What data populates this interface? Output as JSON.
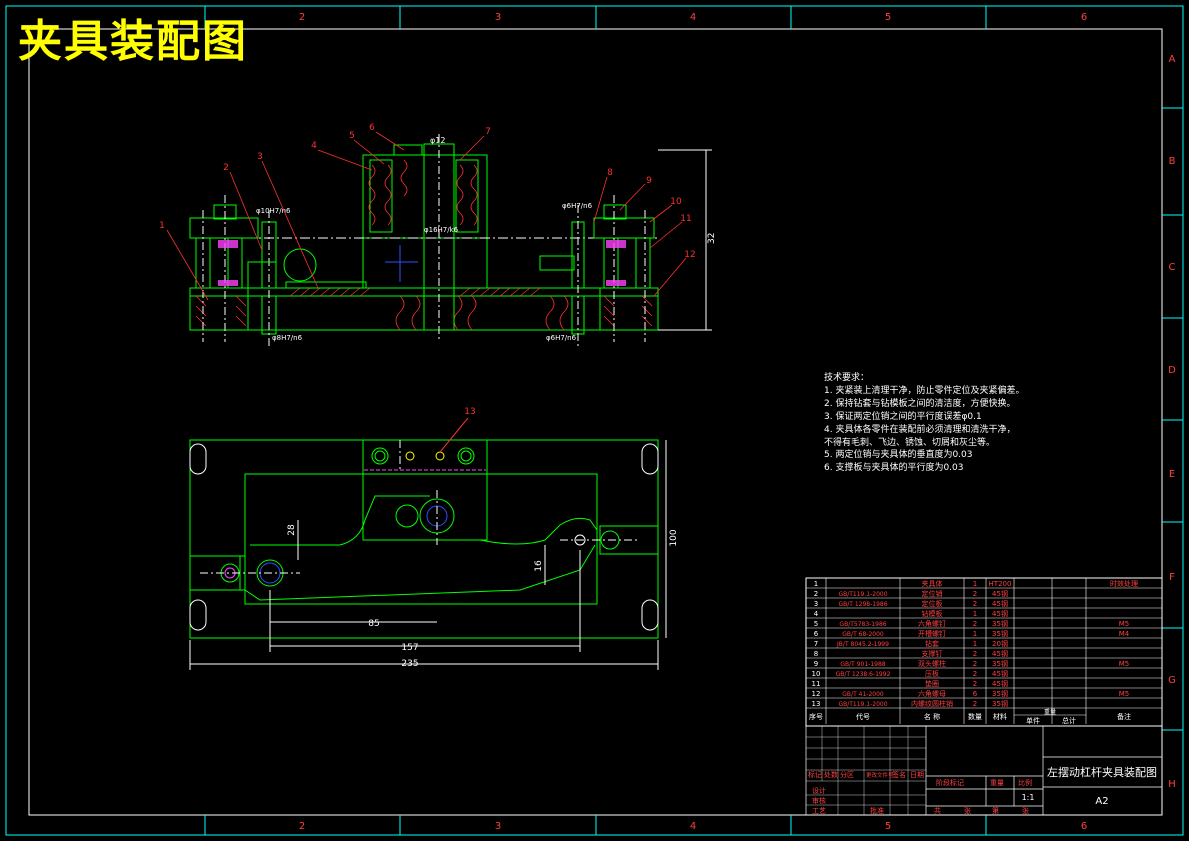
{
  "drawing": {
    "heading": "夹具装配图",
    "grid_columns": [
      "2",
      "3",
      "4",
      "5",
      "6"
    ],
    "grid_rows": [
      "A",
      "B",
      "C",
      "D",
      "E",
      "F",
      "G",
      "H"
    ],
    "front_view": {
      "balloons": [
        "1",
        "2",
        "3",
        "4",
        "5",
        "6",
        "7",
        "8",
        "9",
        "10",
        "11",
        "12"
      ],
      "dims": {
        "d12": "φ12",
        "d16": "φ16H7/k6",
        "d10": "φ10H7/n6",
        "d6": "φ6H7/n6",
        "d8": "φ8H7/n6",
        "d6b": "φ6H7/n6",
        "h32": "32"
      }
    },
    "top_view": {
      "balloons": [
        "13"
      ],
      "dims": {
        "d85": "85",
        "d157": "157",
        "d235": "235",
        "d100": "100",
        "d28": "28",
        "d16": "16"
      }
    },
    "technical_notes": {
      "title": "技术要求：",
      "lines": [
        "1. 夹紧装上清理干净，防止零件定位及夹紧偏差。",
        "2. 保持钻套与钻模板之间的清洁度，方便快换。",
        "3. 保证两定位销之间的平行度误差φ0.1",
        "4. 夹具体各零件在装配前必须清理和清洗干净，",
        "不得有毛刺、飞边、锈蚀、切屑和灰尘等。",
        "5. 两定位销与夹具体的垂直度为0.03",
        "6. 支撑板与夹具体的平行度为0.03"
      ]
    },
    "bom": {
      "headers": [
        "序号",
        "代号",
        "名 称",
        "数量",
        "材料",
        "单件",
        "总计",
        "备注"
      ],
      "weight_header": "重量",
      "rows": [
        [
          "13",
          "GB/T119.1-2000",
          "内螺纹圆柱销",
          "2",
          "35钢",
          "",
          "",
          ""
        ],
        [
          "12",
          "GB/T 41-2000",
          "六角螺母",
          "6",
          "35钢",
          "",
          "",
          "M5"
        ],
        [
          "11",
          "",
          "垫圈",
          "2",
          "45钢",
          "",
          "",
          ""
        ],
        [
          "10",
          "GB/T 1238.6-1992",
          "压板",
          "2",
          "45钢",
          "",
          "",
          ""
        ],
        [
          "9",
          "GB/T 901-1988",
          "双头螺柱",
          "2",
          "35钢",
          "",
          "",
          "M5"
        ],
        [
          "8",
          "",
          "支撑钉",
          "2",
          "45钢",
          "",
          "",
          ""
        ],
        [
          "7",
          "JB/T 8045.2-1999",
          "钻套",
          "1",
          "20钢",
          "",
          "",
          ""
        ],
        [
          "6",
          "GB/T 68-2000",
          "开槽螺钉",
          "1",
          "35钢",
          "",
          "",
          "M4"
        ],
        [
          "5",
          "GB/T5783-1986",
          "六角螺钉",
          "2",
          "35钢",
          "",
          "",
          "M5"
        ],
        [
          "4",
          "",
          "钻模板",
          "1",
          "45钢",
          "",
          "",
          ""
        ],
        [
          "3",
          "GB/T 1298-1986",
          "定位板",
          "2",
          "45钢",
          "",
          "",
          ""
        ],
        [
          "2",
          "GB/T119.1-2000",
          "定位销",
          "2",
          "45钢",
          "",
          "",
          ""
        ],
        [
          "1",
          "",
          "夹具体",
          "1",
          "HT200",
          "",
          "",
          "时效处理"
        ]
      ]
    },
    "title_block": {
      "title": "左摆动杠杆夹具装配图",
      "sheet_size": "A2",
      "scale": "1:1",
      "labels": [
        "设计",
        "审核",
        "工艺",
        "批准",
        "阶段标记",
        "重量",
        "比例",
        "共",
        "张",
        "第",
        "张",
        "标记",
        "处数",
        "分区",
        "更改文件号",
        "签名",
        "日期"
      ]
    }
  }
}
